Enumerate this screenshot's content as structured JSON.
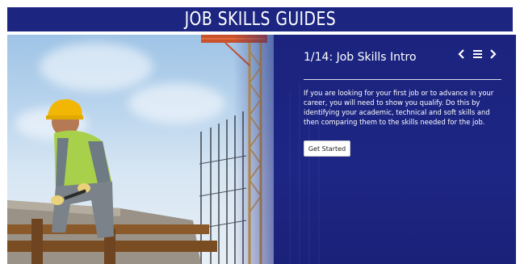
{
  "header": {
    "title": "JOB SKILLS GUIDES"
  },
  "slide": {
    "title": "1/14: Job Skills Intro",
    "body": "If you are looking for your first job or to advance in your career, you will need to show you qualify. Do this by identifying your academic, technical and soft skills and then comparing them to the skills needed for the job.",
    "button_label": "Get Started"
  },
  "nav": {
    "prev_icon": "chevron-left-icon",
    "menu_icon": "menu-icon",
    "next_icon": "chevron-right-icon"
  },
  "colors": {
    "title_bar": "#1c2580",
    "panel": "#1d2684",
    "text": "#ffffff",
    "hardhat": "#f2b705",
    "vest": "#a8d04a"
  }
}
